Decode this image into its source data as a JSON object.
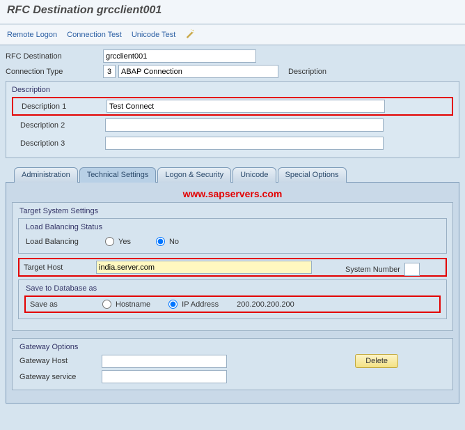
{
  "title": "RFC Destination grcclient001",
  "toolbar": {
    "remote_logon": "Remote Logon",
    "connection_test": "Connection Test",
    "unicode_test": "Unicode Test"
  },
  "header": {
    "rfc_dest_label": "RFC Destination",
    "rfc_dest_value": "grcclient001",
    "conn_type_label": "Connection Type",
    "conn_type_code": "3",
    "conn_type_text": "ABAP Connection",
    "description_label": "Description"
  },
  "description_block": {
    "title": "Description",
    "desc1_label": "Description 1",
    "desc1_value": "Test Connect",
    "desc2_label": "Description 2",
    "desc2_value": "",
    "desc3_label": "Description 3",
    "desc3_value": ""
  },
  "tabs": {
    "administration": "Administration",
    "technical": "Technical Settings",
    "logon": "Logon & Security",
    "unicode": "Unicode",
    "special": "Special Options"
  },
  "watermark": "www.sapservers.com",
  "target_settings": {
    "group_label": "Target System Settings",
    "load_bal_group": "Load Balancing Status",
    "load_bal_label": "Load Balancing",
    "yes": "Yes",
    "no": "No",
    "target_host_label": "Target Host",
    "target_host_value": "india.server.com",
    "system_number_label": "System Number",
    "system_number_value": "",
    "save_db_group": "Save to Database as",
    "save_as_label": "Save as",
    "hostname": "Hostname",
    "ip_address": "IP Address",
    "ip_value": "200.200.200.200"
  },
  "gateway": {
    "group_label": "Gateway Options",
    "host_label": "Gateway Host",
    "host_value": "",
    "service_label": "Gateway service",
    "service_value": "",
    "delete_btn": "Delete"
  }
}
